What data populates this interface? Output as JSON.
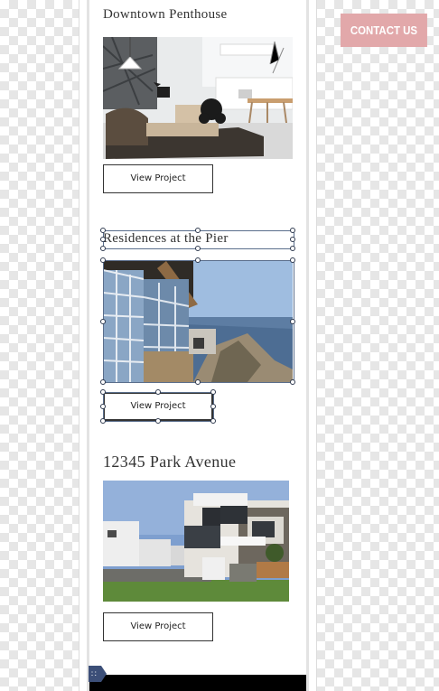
{
  "header": {
    "contact_label": "CONTACT US",
    "contact_color": "#e2a8aa"
  },
  "projects": [
    {
      "title": "Downtown Penthouse",
      "image": "modern-living-room-photo",
      "button_label": "View Project"
    },
    {
      "title": "Residences at the Pier",
      "image": "cliffside-house-ocean-view-photo",
      "button_label": "View Project",
      "selected": true
    },
    {
      "title": "12345 Park Avenue",
      "image": "modern-townhouse-exterior-photo",
      "button_label": "View Project"
    }
  ],
  "editor": {
    "grid_icon": "grid-icon",
    "selection_color": "#5a6e8c"
  }
}
